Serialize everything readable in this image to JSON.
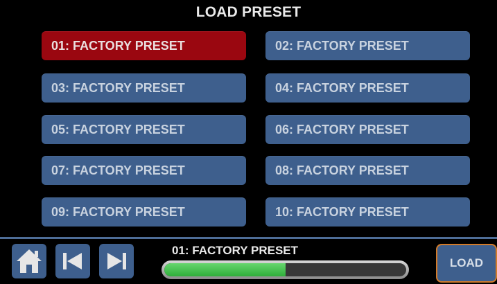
{
  "title": "LOAD PRESET",
  "presets": [
    {
      "label": "01: FACTORY PRESET",
      "selected": true
    },
    {
      "label": "02: FACTORY PRESET",
      "selected": false
    },
    {
      "label": "03: FACTORY PRESET",
      "selected": false
    },
    {
      "label": "04: FACTORY PRESET",
      "selected": false
    },
    {
      "label": "05: FACTORY PRESET",
      "selected": false
    },
    {
      "label": "06: FACTORY PRESET",
      "selected": false
    },
    {
      "label": "07: FACTORY PRESET",
      "selected": false
    },
    {
      "label": "08: FACTORY PRESET",
      "selected": false
    },
    {
      "label": "09: FACTORY PRESET",
      "selected": false
    },
    {
      "label": "10: FACTORY PRESET",
      "selected": false
    }
  ],
  "footer": {
    "current_preset": "01: FACTORY PRESET",
    "progress_fraction": 0.5,
    "load_label": "LOAD",
    "icons": {
      "home": "home-icon",
      "prev": "skip-previous-icon",
      "next": "skip-next-icon"
    }
  },
  "colors": {
    "button": "#3e5f8d",
    "selected": "#9a0710",
    "progress": "#4cc554",
    "load_border": "#d27b2a"
  }
}
